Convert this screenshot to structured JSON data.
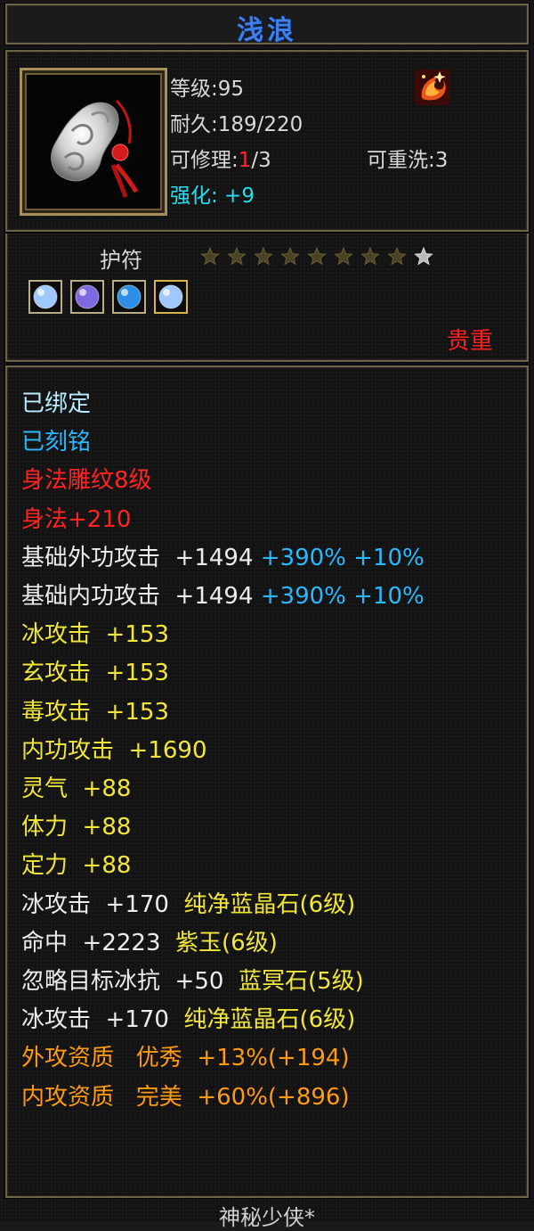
{
  "item": {
    "name": "浅浪",
    "category": "护符",
    "rarity": "贵重",
    "stars_filled": 8,
    "stars_total": 9,
    "icon": "amulet-icon",
    "emblem_icon": "phoenix-emblem-icon"
  },
  "stats": {
    "level_label": "等级:",
    "level_value": "95",
    "durability_label": "耐久:",
    "durability_value": "189/220",
    "repair_label": "可修理:",
    "repair_current": "1",
    "repair_max": "/3",
    "rewash_label": "可重洗:",
    "rewash_value": "3",
    "enhance_label": "强化:",
    "enhance_value": " +9"
  },
  "gems": [
    {
      "icon": "gem-ice-icon",
      "color": "#9fc8ff"
    },
    {
      "icon": "gem-purple-icon",
      "color": "#7d6ae0"
    },
    {
      "icon": "gem-blue-icon",
      "color": "#2c8ee8"
    },
    {
      "icon": "gem-ice-icon",
      "color": "#9fc8ff"
    }
  ],
  "properties": [
    [
      {
        "t": "已绑定",
        "c": "lightcyan"
      }
    ],
    [
      {
        "t": "已刻铭",
        "c": "blue"
      }
    ],
    [
      {
        "t": "身法雕纹8级",
        "c": "red"
      }
    ],
    [
      {
        "t": "身法+210",
        "c": "red"
      }
    ],
    [
      {
        "t": "基础外功攻击  +1494 ",
        "c": "white"
      },
      {
        "t": "+390% +10%",
        "c": "blue"
      }
    ],
    [
      {
        "t": "基础内功攻击  +1494 ",
        "c": "white"
      },
      {
        "t": "+390% +10%",
        "c": "blue"
      }
    ],
    [
      {
        "t": "冰攻击  +153",
        "c": "yellow"
      }
    ],
    [
      {
        "t": "玄攻击  +153",
        "c": "yellow"
      }
    ],
    [
      {
        "t": "毒攻击  +153",
        "c": "yellow"
      }
    ],
    [
      {
        "t": "内功攻击  +1690",
        "c": "yellow"
      }
    ],
    [
      {
        "t": "灵气  +88",
        "c": "yellow"
      }
    ],
    [
      {
        "t": "体力  +88",
        "c": "yellow"
      }
    ],
    [
      {
        "t": "定力  +88",
        "c": "yellow"
      }
    ],
    [
      {
        "t": "冰攻击  +170  ",
        "c": "white"
      },
      {
        "t": "纯净蓝晶石(6级)",
        "c": "yellow"
      }
    ],
    [
      {
        "t": "命中  +2223  ",
        "c": "white"
      },
      {
        "t": "紫玉(6级)",
        "c": "yellow"
      }
    ],
    [
      {
        "t": "忽略目标冰抗  +50  ",
        "c": "white"
      },
      {
        "t": "蓝冥石(5级)",
        "c": "yellow"
      }
    ],
    [
      {
        "t": "冰攻击  +170  ",
        "c": "white"
      },
      {
        "t": "纯净蓝晶石(6级)",
        "c": "yellow"
      }
    ],
    [
      {
        "t": "外攻资质   优秀  +13%(+194)",
        "c": "orange"
      }
    ],
    [
      {
        "t": "内攻资质   完美  +60%(+896)",
        "c": "orange"
      }
    ]
  ],
  "footer": {
    "maker": "神秘少侠*"
  },
  "colors": {
    "title_blue": "#3f7fe6",
    "rarity_red": "#ff2020",
    "enhance_cyan": "#22e0f0",
    "property_yellow": "#f2e63c",
    "property_orange": "#ff9a12"
  }
}
